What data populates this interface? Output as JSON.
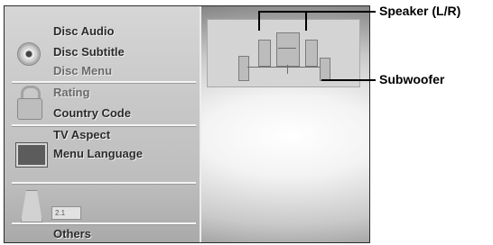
{
  "menu": {
    "items": [
      "Disc Audio",
      "Disc Subtitle",
      "Disc Menu",
      "Rating",
      "Country Code",
      "TV Aspect",
      "Menu Language",
      "",
      "2.1",
      "Others"
    ]
  },
  "callouts": {
    "speaker": "Speaker (L/R)",
    "subwoofer": "Subwoofer"
  }
}
